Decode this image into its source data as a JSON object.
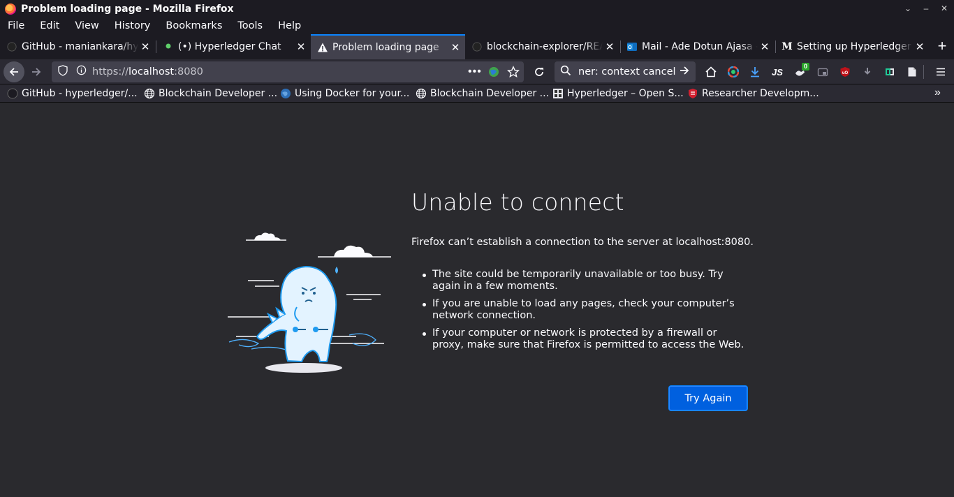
{
  "window": {
    "title": "Problem loading page - Mozilla Firefox",
    "controls": [
      "⌄",
      "–",
      "✕"
    ]
  },
  "menu": [
    "File",
    "Edit",
    "View",
    "History",
    "Bookmarks",
    "Tools",
    "Help"
  ],
  "tabs": [
    {
      "label": "GitHub - maniankara/hyperledger-fabric-tls-cert-gen",
      "icon": "github-icon",
      "active": false
    },
    {
      "label": "(•) Hyperledger Chat",
      "icon": "rocketchat-icon",
      "active": false
    },
    {
      "label": "Problem loading page",
      "icon": "warning-icon",
      "active": true
    },
    {
      "label": "blockchain-explorer/README.md",
      "icon": "github-icon",
      "active": false
    },
    {
      "label": "Mail - Ade Dotun Ajasa - Outlook",
      "icon": "outlook-icon",
      "active": false
    },
    {
      "label": "Setting up Hyperledger Explorer",
      "icon": "medium-icon",
      "active": false
    }
  ],
  "url": {
    "prefix": "https://",
    "host": "localhost",
    "port": ":8080"
  },
  "search": {
    "value": "ner: context canceled"
  },
  "toolbar_badge": "0",
  "bookmarks": [
    {
      "label": "GitHub - hyperledger/...",
      "icon": "github-icon"
    },
    {
      "label": "Blockchain Developer ...",
      "icon": "globe-icon"
    },
    {
      "label": "Using Docker for your...",
      "icon": "globe-blue-icon"
    },
    {
      "label": "Blockchain Developer ...",
      "icon": "globe-icon"
    },
    {
      "label": "Hyperledger – Open S...",
      "icon": "hyperledger-icon"
    },
    {
      "label": "Researcher Developm...",
      "icon": "shield-icon"
    }
  ],
  "error": {
    "title": "Unable to connect",
    "description": "Firefox can’t establish a connection to the server at localhost:8080.",
    "bullets": [
      "The site could be temporarily unavailable or too busy. Try again in a few moments.",
      "If you are unable to load any pages, check your computer’s network connection.",
      "If your computer or network is protected by a firewall or proxy, make sure that Firefox is permitted to access the Web."
    ],
    "button": "Try Again"
  },
  "colors": {
    "chrome": "#1c1b22",
    "toolbar": "#2b2a33",
    "content": "#2a2a2e",
    "accent": "#0a84ff",
    "button": "#0060df"
  }
}
